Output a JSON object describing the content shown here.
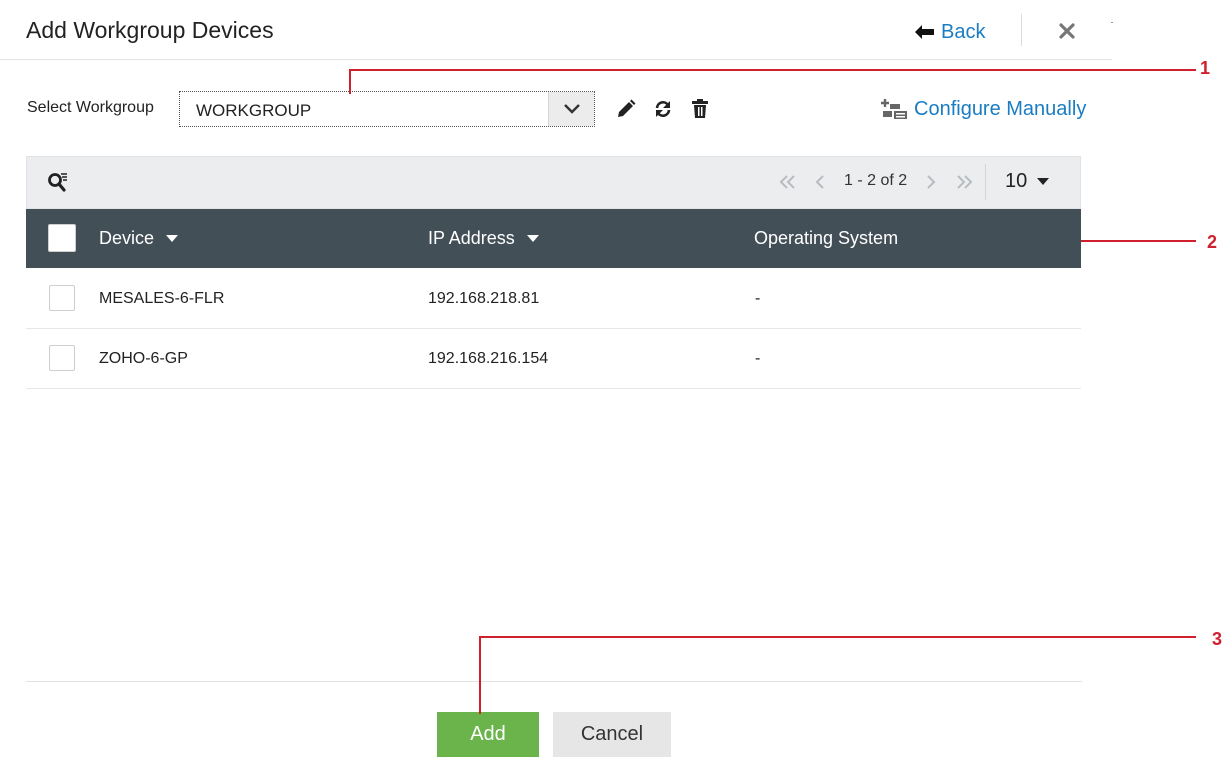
{
  "header": {
    "title": "Add Workgroup Devices",
    "back_label": "Back"
  },
  "workgroup": {
    "label": "Select Workgroup",
    "selected": "WORKGROUP",
    "configure_manually": "Configure Manually"
  },
  "pagination": {
    "range_text": "1 - 2 of 2",
    "per_page": "10"
  },
  "table": {
    "columns": [
      "Device",
      "IP Address",
      "Operating System"
    ],
    "rows": [
      {
        "device": "MESALES-6-FLR",
        "ip": "192.168.218.81",
        "os": "-"
      },
      {
        "device": "ZOHO-6-GP",
        "ip": "192.168.216.154",
        "os": "-"
      }
    ]
  },
  "footer": {
    "add_label": "Add",
    "cancel_label": "Cancel"
  },
  "callouts": [
    "1",
    "2",
    "3"
  ],
  "colors": {
    "link": "#1a7dc1",
    "table_header": "#434f57",
    "add_button": "#6bb34b",
    "callout": "#d0202e"
  },
  "icons": [
    "back-arrow-icon",
    "close-icon",
    "chevron-down-icon",
    "edit-icon",
    "refresh-icon",
    "trash-icon",
    "configure-manually-icon",
    "search-filter-icon",
    "first-page-icon",
    "prev-page-icon",
    "next-page-icon",
    "last-page-icon",
    "sort-desc-icon"
  ]
}
